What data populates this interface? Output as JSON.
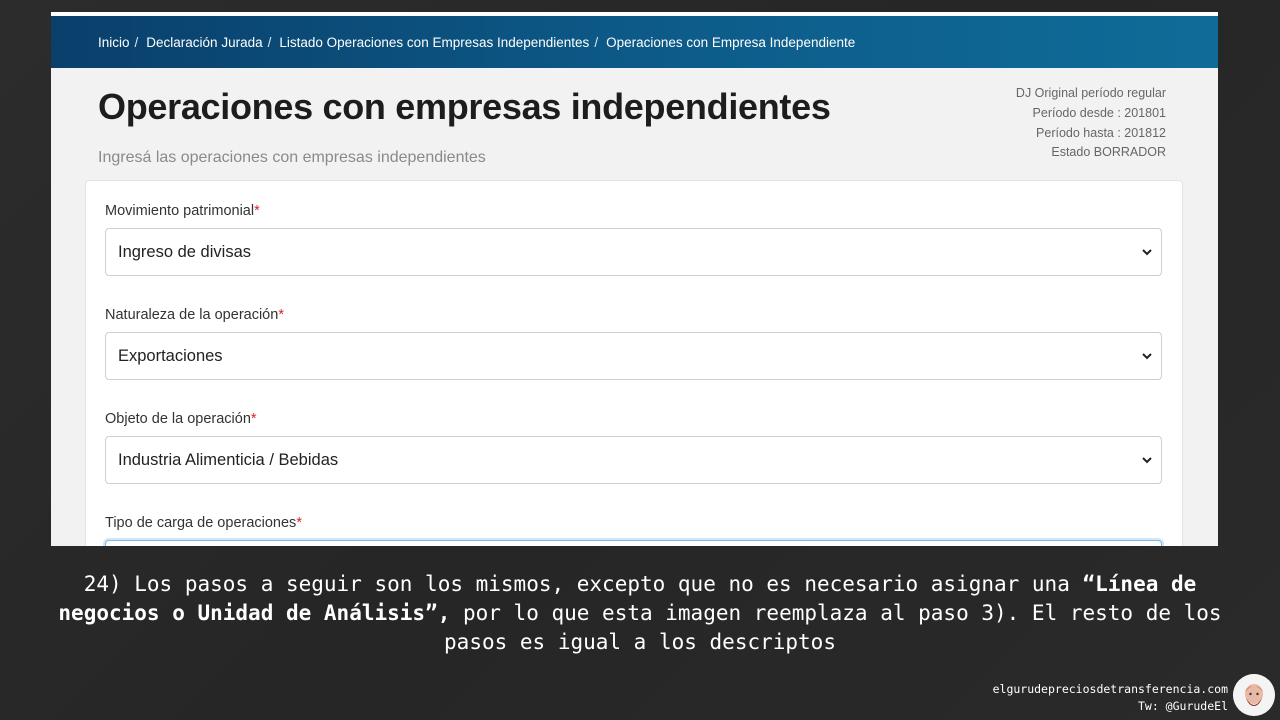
{
  "breadcrumb": {
    "items": [
      "Inicio",
      "Declaración Jurada",
      "Listado Operaciones con Empresas Independientes",
      "Operaciones con Empresa Independiente"
    ],
    "separator": "/"
  },
  "page": {
    "title": "Operaciones con empresas independientes",
    "subtitle": "Ingresá las operaciones con empresas independientes",
    "meta": [
      "DJ Original período regular",
      "Período desde : 201801",
      "Período hasta : 201812",
      "Estado BORRADOR"
    ]
  },
  "form": {
    "required_marker": "*",
    "fields": [
      {
        "label": "Movimiento patrimonial",
        "value": "Ingreso de divisas"
      },
      {
        "label": "Naturaleza de la operación",
        "value": "Exportaciones"
      },
      {
        "label": "Objeto de la operación",
        "value": "Industria Alimenticia / Bebidas"
      },
      {
        "label": "Tipo de carga de operaciones",
        "value": ""
      }
    ]
  },
  "caption": {
    "part1": "24) Los pasos a seguir son los mismos, excepto que no es necesario asignar una ",
    "bold": "“Línea de negocios o Unidad de Análisis”,",
    "part2": " por lo que esta imagen reemplaza al paso 3). El resto de los pasos es igual a los descriptos"
  },
  "footer": {
    "website": "elgurudepreciosdetransferencia.com",
    "twitter": "Tw: @GurudeEl"
  },
  "colors": {
    "navbar": "#0d5c8a",
    "required": "#d9232d",
    "focus_border": "#7ab8ec"
  },
  "icons": [
    "chevron-down-icon",
    "avatar-logo"
  ]
}
